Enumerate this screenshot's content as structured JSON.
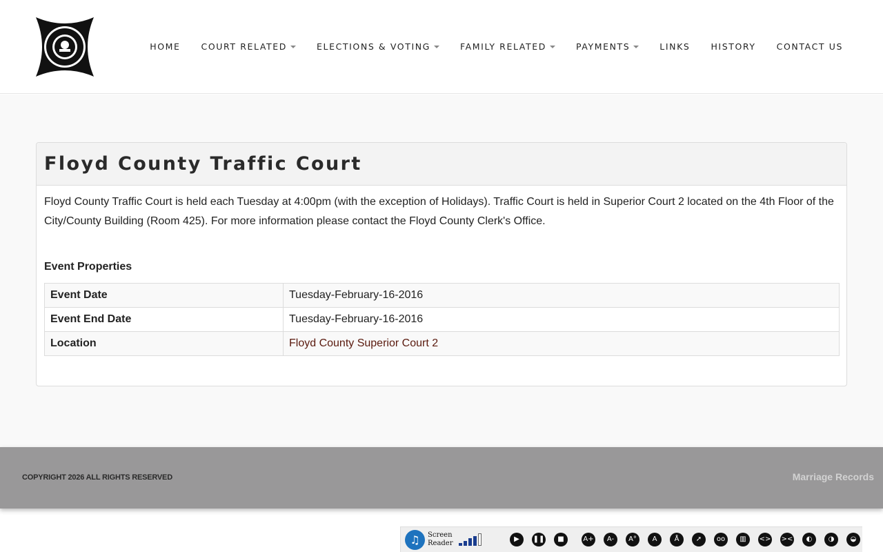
{
  "header": {
    "nav": [
      {
        "label": "HOME",
        "dropdown": false
      },
      {
        "label": "COURT RELATED",
        "dropdown": true
      },
      {
        "label": "ELECTIONS & VOTING",
        "dropdown": true
      },
      {
        "label": "FAMILY RELATED",
        "dropdown": true
      },
      {
        "label": "PAYMENTS",
        "dropdown": true
      },
      {
        "label": "LINKS",
        "dropdown": false
      },
      {
        "label": "HISTORY",
        "dropdown": false
      },
      {
        "label": "CONTACT US",
        "dropdown": false
      }
    ]
  },
  "main": {
    "title": "Floyd County Traffic Court",
    "description": "Floyd County Traffic Court is held each Tuesday at 4:00pm (with the exception of Holidays). Traffic Court is held in Superior Court 2 located on the 4th Floor of the City/County Building (Room 425).  For more information please contact the Floyd County Clerk's Office.",
    "properties_title": "Event Properties",
    "properties": [
      {
        "key": "Event Date",
        "value": "Tuesday-February-16-2016"
      },
      {
        "key": "Event End Date",
        "value": "Tuesday-February-16-2016"
      },
      {
        "key": "Location",
        "value": "Floyd County Superior Court 2"
      }
    ]
  },
  "footer": {
    "copyright": "COPYRIGHT 2026 ALL RIGHTS RESERVED",
    "link": "Marriage Records"
  },
  "a11y_toolbar": {
    "label_line1": "Screen",
    "label_line2": "Reader",
    "volume_level": 0.8,
    "controls": [
      {
        "name": "play-icon",
        "glyph": "▶"
      },
      {
        "name": "pause-icon",
        "glyph": "❚❚"
      },
      {
        "name": "stop-icon",
        "glyph": "■"
      },
      {
        "name": "increase-text-icon",
        "glyph": "A+"
      },
      {
        "name": "decrease-text-icon",
        "glyph": "A-"
      },
      {
        "name": "reset-text-icon",
        "glyph": "A°"
      },
      {
        "name": "font-icon",
        "glyph": "A"
      },
      {
        "name": "dyslexic-font-icon",
        "glyph": "Å"
      },
      {
        "name": "cursor-icon",
        "glyph": "➚"
      },
      {
        "name": "reading-glasses-icon",
        "glyph": "oo"
      },
      {
        "name": "reading-mode-icon",
        "glyph": "▥"
      },
      {
        "name": "expand-spacing-icon",
        "glyph": "<>"
      },
      {
        "name": "shrink-spacing-icon",
        "glyph": "><"
      },
      {
        "name": "contrast-icon",
        "glyph": "◐"
      },
      {
        "name": "grayscale-icon",
        "glyph": "◑"
      },
      {
        "name": "invert-colors-icon",
        "glyph": "◒"
      }
    ]
  },
  "colors": {
    "link": "#5a1a0e",
    "footer_bg": "#999899",
    "toolbar_blue": "#1e73be"
  }
}
